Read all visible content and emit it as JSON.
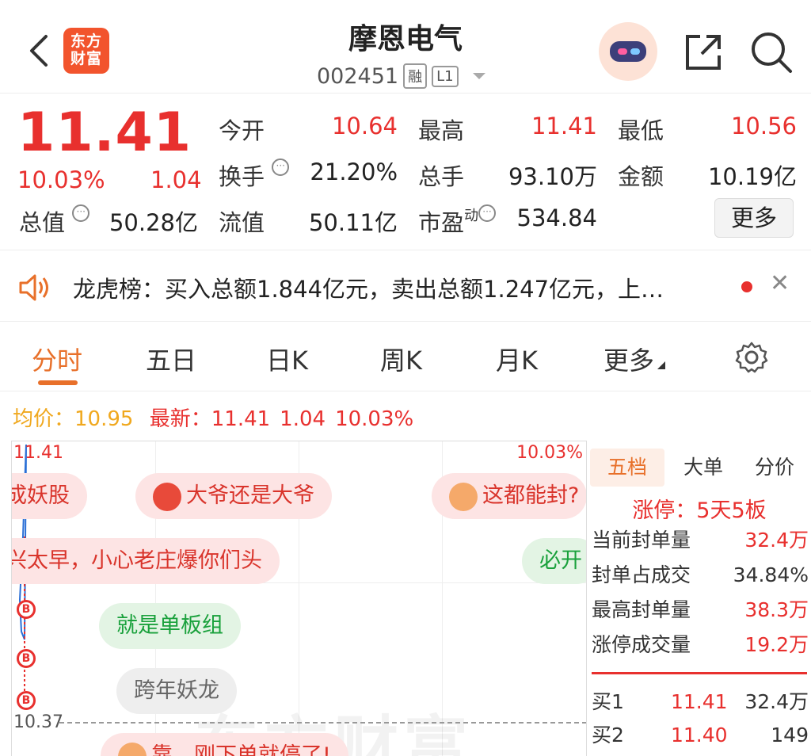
{
  "header": {
    "logo_line1": "东方",
    "logo_line2": "财富",
    "title": "摩恩电气",
    "code": "002451",
    "tag_margin": "融",
    "tag_level": "L1"
  },
  "quote": {
    "price": "11.41",
    "change_pct": "10.03%",
    "change_abs": "1.04",
    "fields": {
      "open_label": "今开",
      "open_value": "10.64",
      "high_label": "最高",
      "high_value": "11.41",
      "low_label": "最低",
      "low_value": "10.56",
      "turnover_label": "换手",
      "turnover_value": "21.20%",
      "volume_label": "总手",
      "volume_value": "93.10万",
      "amount_label": "金额",
      "amount_value": "10.19亿",
      "mktcap_label": "总值",
      "mktcap_value": "50.28亿",
      "float_label": "流值",
      "float_value": "50.11亿",
      "pe_label": "市盈",
      "pe_sup": "动",
      "pe_value": "534.84"
    },
    "more_label": "更多"
  },
  "banner": {
    "text": "龙虎榜：买入总额1.844亿元，卖出总额1.247亿元，上…"
  },
  "tabs": [
    "分时",
    "五日",
    "日K",
    "周K",
    "月K",
    "更多"
  ],
  "summary": {
    "avg_label": "均价：",
    "avg_value": "10.95",
    "latest_label": "最新：",
    "latest_value": "11.41",
    "latest_change": "1.04",
    "latest_pct": "10.03%"
  },
  "chart_data": {
    "type": "line",
    "top_label": "11.41",
    "top_pct": "10.03%",
    "bottom_label": "10.37",
    "marker_label": "B",
    "watermark": "东方财富"
  },
  "comments": {
    "c1": "成妖股",
    "c2": "大爷还是大爷",
    "c3": "这都能封?",
    "c4": "兴太早，小心老庄爆你们头",
    "c5": "必开",
    "c6": "就是单板组",
    "c7": "跨年妖龙",
    "c8": "靠，刚下单就停了!"
  },
  "book": {
    "tabs": [
      "五档",
      "大单",
      "分价"
    ],
    "limit_text": "涨停：5天5板",
    "rows": [
      {
        "label": "当前封单量",
        "value": "32.4万"
      },
      {
        "label": "封单占成交",
        "value": "34.84%"
      },
      {
        "label": "最高封单量",
        "value": "38.3万"
      },
      {
        "label": "涨停成交量",
        "value": "19.2万"
      }
    ],
    "levels": [
      {
        "label": "买1",
        "price": "11.41",
        "qty": "32.4万"
      },
      {
        "label": "买2",
        "price": "11.40",
        "qty": "149"
      }
    ]
  },
  "colors": {
    "up": "#e8302e",
    "accent": "#e8702a",
    "avg_line": "#f0a81e",
    "green": "#1aa13c"
  }
}
